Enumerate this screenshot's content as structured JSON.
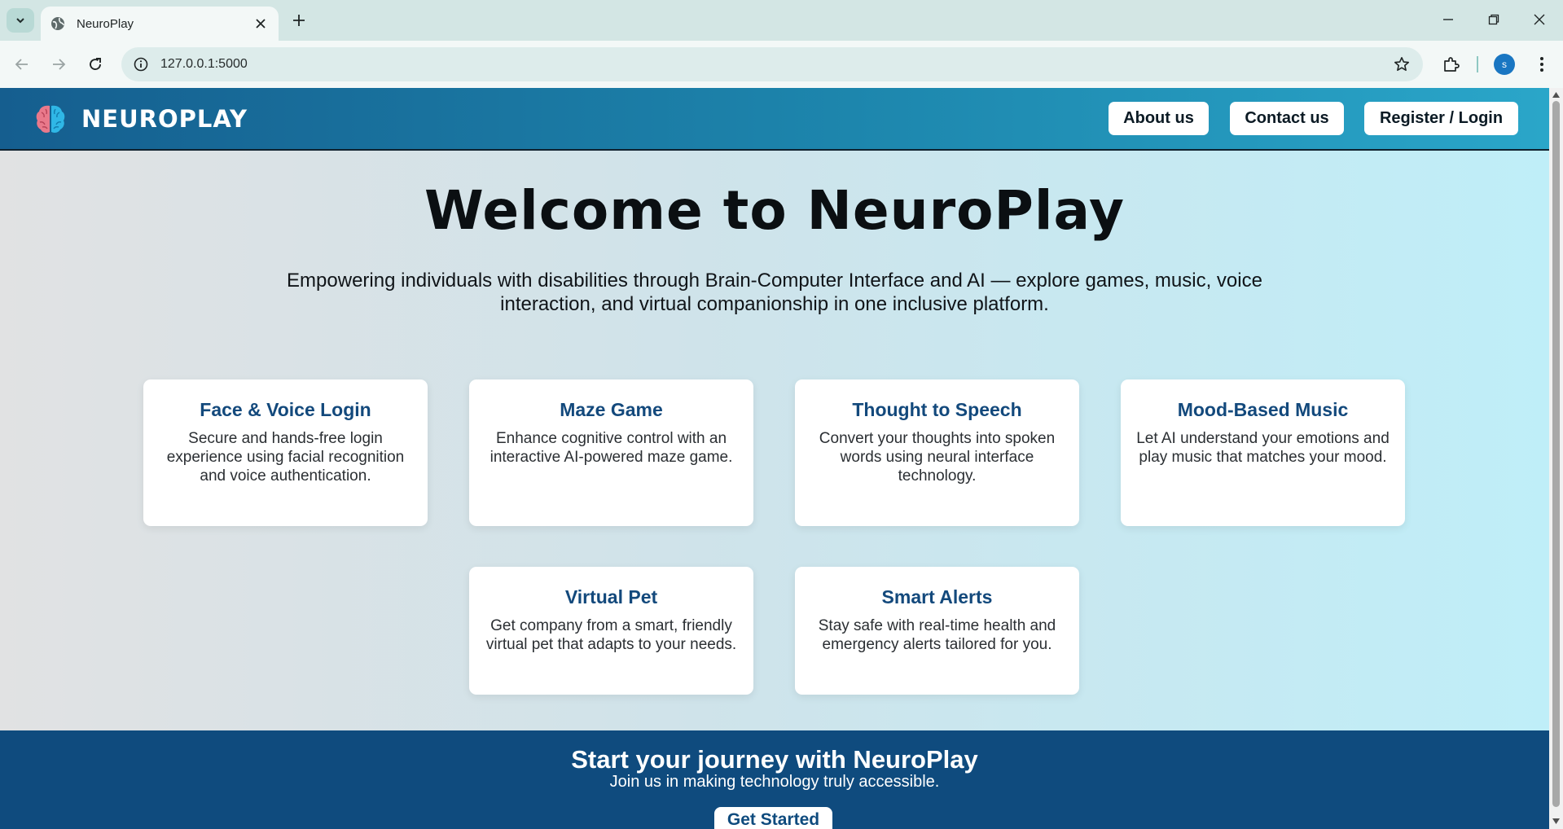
{
  "browser": {
    "tab_title": "NeuroPlay",
    "url": "127.0.0.1:5000",
    "profile_initial": "s"
  },
  "site": {
    "brand": "NEUROPLAY",
    "nav": {
      "about": "About us",
      "contact": "Contact us",
      "register": "Register / Login"
    },
    "hero": {
      "title": "Welcome to NeuroPlay",
      "subtitle": "Empowering individuals with disabilities through Brain-Computer Interface and AI — explore games, music, voice interaction, and virtual companionship in one inclusive platform."
    },
    "features": [
      {
        "title": "Face & Voice Login",
        "text": "Secure and hands-free login experience using facial recognition and voice authentication."
      },
      {
        "title": "Maze Game",
        "text": "Enhance cognitive control with an interactive AI-powered maze game."
      },
      {
        "title": "Thought to Speech",
        "text": "Convert your thoughts into spoken words using neural interface technology."
      },
      {
        "title": "Mood-Based Music",
        "text": "Let AI understand your emotions and play music that matches your mood."
      },
      {
        "title": "Virtual Pet",
        "text": "Get company from a smart, friendly virtual pet that adapts to your needs."
      },
      {
        "title": "Smart Alerts",
        "text": "Stay safe with real-time health and emergency alerts tailored for you."
      }
    ],
    "cta": {
      "title": "Start your journey with NeuroPlay",
      "subtitle": "Join us in making technology truly accessible.",
      "button": "Get Started"
    }
  },
  "colors": {
    "header_start": "#155e8f",
    "header_end": "#2aa6c9",
    "card_title": "#13497c",
    "cta_bg": "#0f4b7e"
  }
}
